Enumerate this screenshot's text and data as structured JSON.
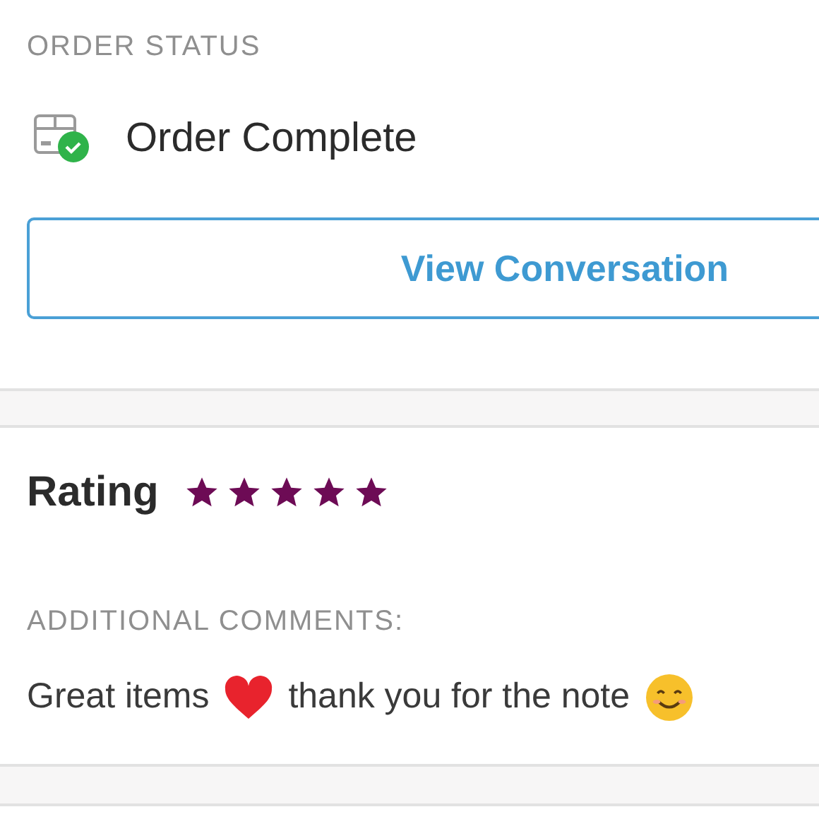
{
  "order_status": {
    "heading": "ORDER STATUS",
    "status": "Order Complete",
    "complete": true,
    "button": "View Conversation"
  },
  "rating": {
    "label": "Rating",
    "stars": 5
  },
  "comments": {
    "heading": "ADDITIONAL COMMENTS:",
    "parts": [
      {
        "kind": "text",
        "text": "Great items"
      },
      {
        "kind": "heart"
      },
      {
        "kind": "text",
        "text": "thank you for the note"
      },
      {
        "kind": "smile"
      }
    ]
  }
}
